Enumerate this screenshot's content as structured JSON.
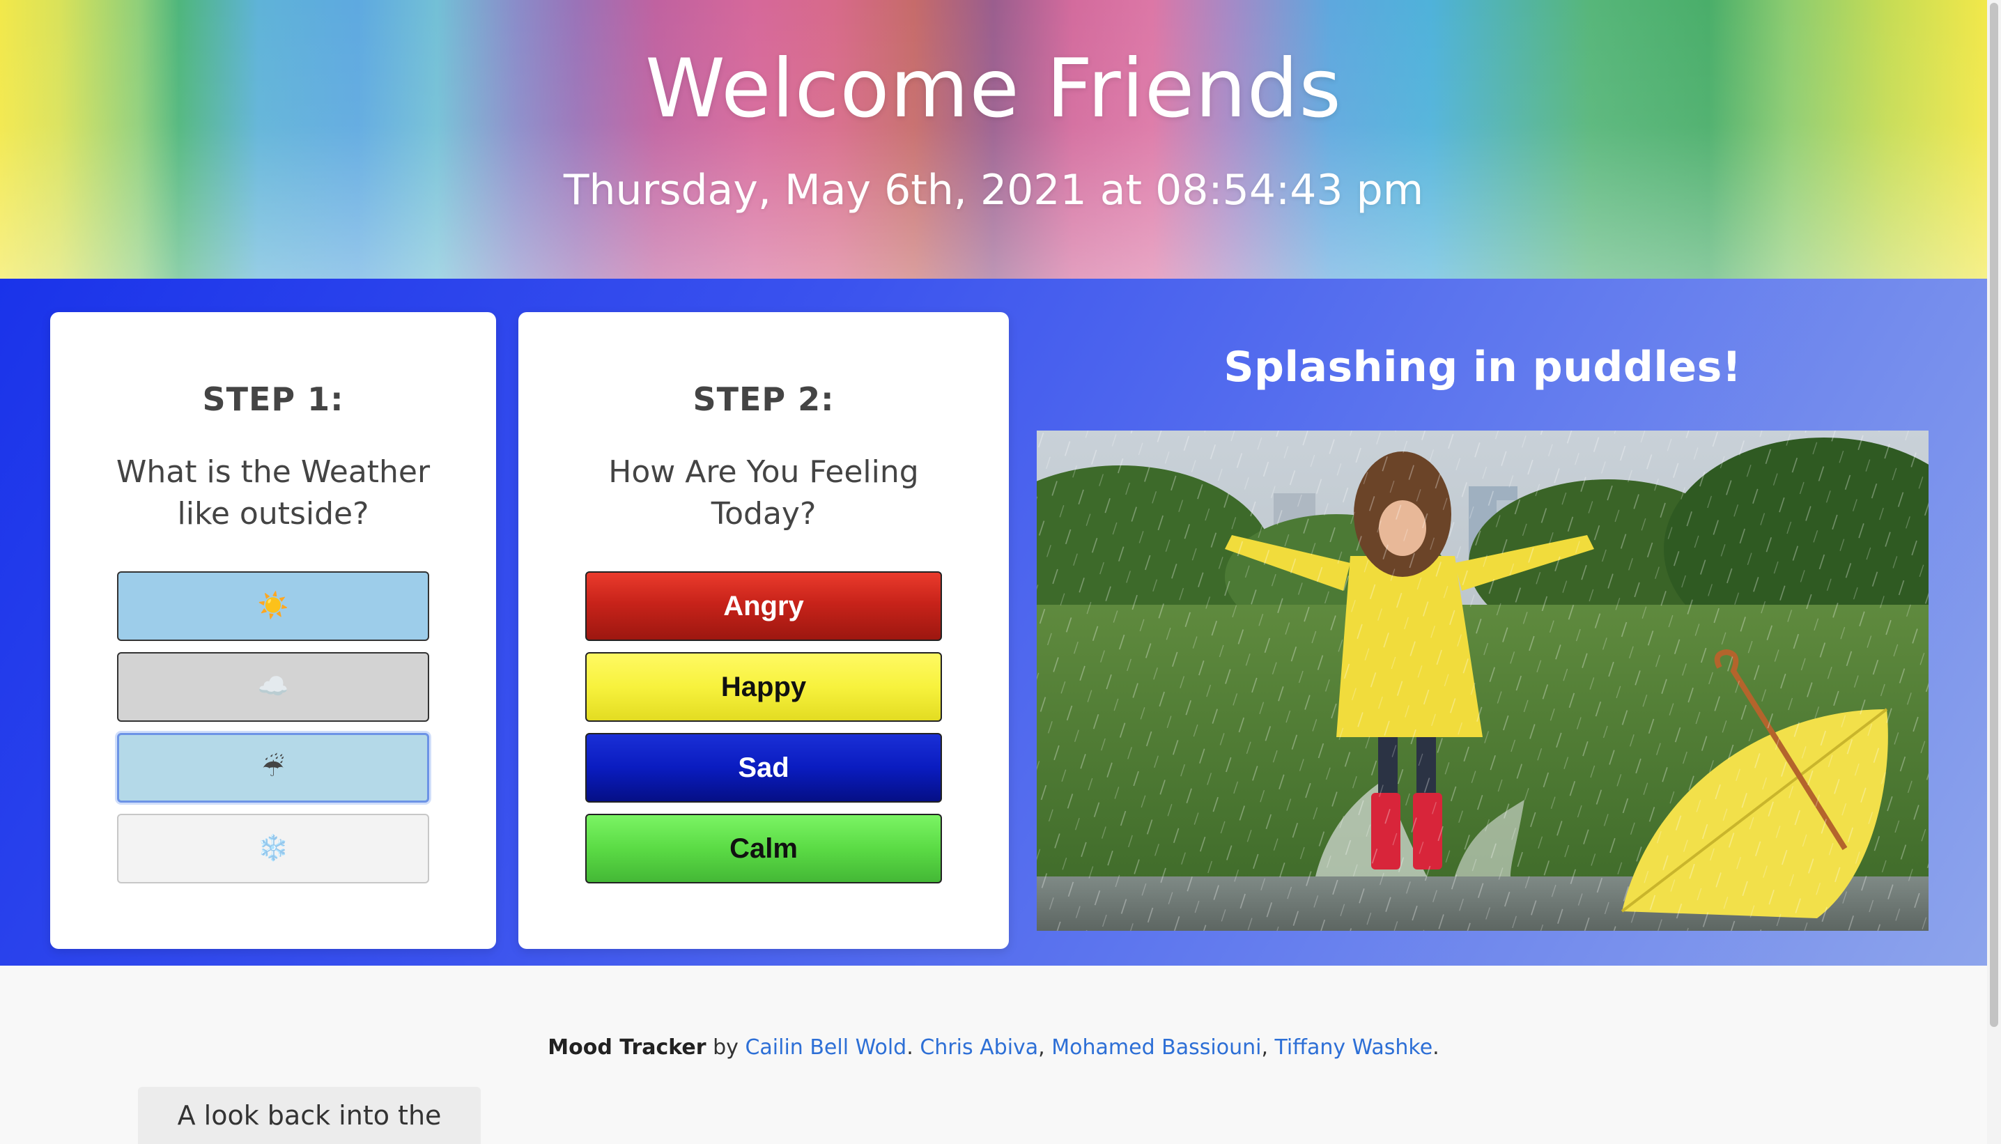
{
  "header": {
    "title": "Welcome Friends",
    "datetime": "Thursday, May 6th, 2021 at 08:54:43 pm"
  },
  "step1": {
    "step_label": "STEP 1:",
    "question": "What is the Weather like outside?",
    "options": [
      {
        "name": "sunny",
        "glyph": "☀️",
        "color": "#9dcdea"
      },
      {
        "name": "cloudy",
        "glyph": "☁️",
        "color": "#d3d3d3"
      },
      {
        "name": "rainy",
        "glyph": "☔",
        "color": "#b4d9e8"
      },
      {
        "name": "snowy",
        "glyph": "❄️",
        "color": "#f3f3f3"
      }
    ]
  },
  "step2": {
    "step_label": "STEP 2:",
    "question": "How Are You Feeling Today?",
    "moods": [
      {
        "label": "Angry",
        "color": "#c8231a"
      },
      {
        "label": "Happy",
        "color": "#f7f23d"
      },
      {
        "label": "Sad",
        "color": "#0a1cc0"
      },
      {
        "label": "Calm",
        "color": "#5bdb45"
      }
    ]
  },
  "feature": {
    "caption": "Splashing in puddles!"
  },
  "footer": {
    "brand": "Mood Tracker",
    "by": "by",
    "authors": [
      "Cailin Bell Wold",
      "Chris Abiva",
      "Mohamed Bassiouni",
      "Tiffany Washke"
    ],
    "sep1": ".",
    "sep2": ",",
    "sep3": ",",
    "end": ".",
    "past_button": "A look back into the past..."
  },
  "colors": {
    "band_start": "#1a33ea",
    "band_end": "#8da4ec",
    "link": "#2d6fd6"
  }
}
